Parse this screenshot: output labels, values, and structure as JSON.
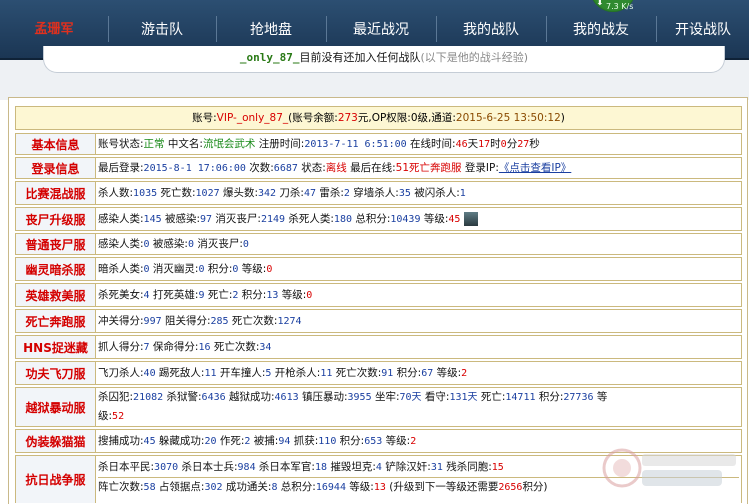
{
  "nav": {
    "brand": "孟珊军",
    "items": [
      "游击队",
      "抢地盘",
      "最近战况",
      "我的战队",
      "我的战友",
      "开设战队"
    ],
    "speed": "7.3 K/s"
  },
  "tab": {
    "username": "_only_87_",
    "message": "目前没有还加入任何战队",
    "hint": "(以下是他的战斗经验)"
  },
  "account": {
    "label_account": "账号:",
    "account": "VIP-_only_87_",
    "label_balance": "(账号余额:",
    "balance": "273",
    "label_op": "元,OP权限:",
    "op": "0级",
    "label_channel": ",通道:",
    "channel_time": "2015-6-25 13:50:12",
    "close": ")"
  },
  "basic": {
    "label": "基本信息",
    "status_label": "账号状态:",
    "status": "正常",
    "cname_label": "中文名:",
    "cname": "流氓会武术",
    "reg_label": "注册时间:",
    "reg_time": "2013-7-11 6:51:00",
    "online_label": "在线时间:",
    "online_d": "46",
    "online_h": "17",
    "online_m": "0",
    "online_s": "27"
  },
  "login": {
    "label": "登录信息",
    "last_label": "最后登录:",
    "last": "2015-8-1 17:06:00",
    "times_label": "次数:",
    "times": "6687",
    "state_label": "状态:",
    "state": "离线",
    "where_label": "最后在线:",
    "where": "51死亡奔跑服",
    "ip_label": "登录IP:",
    "ip": "《点击查看IP》"
  },
  "rows": {
    "mix": {
      "label": "比赛混战服",
      "text": [
        "杀人数:",
        "1035",
        " 死亡数:",
        "1027",
        " 爆头数:",
        "342",
        " 刀杀:",
        "47",
        " 雷杀:",
        "2",
        " 穿墙杀人:",
        "35",
        " 被闪杀人:",
        "1"
      ]
    },
    "zombie": {
      "label": "丧尸升级服",
      "text": [
        "感染人类:",
        "145",
        " 被感染:",
        "97",
        " 消灭丧尸:",
        "2149",
        " 杀死人类:",
        "180",
        " 总积分:",
        "10439",
        " 等级:",
        "45"
      ]
    },
    "normal": {
      "label": "普通丧尸服",
      "text": [
        "感染人类:",
        "0",
        " 被感染:",
        "0",
        " 消灭丧尸:",
        "0"
      ]
    },
    "ghost": {
      "label": "幽灵暗杀服",
      "text": [
        "暗杀人类:",
        "0",
        " 消灭幽灵:",
        "0",
        " 积分:",
        "0",
        " 等级:",
        "0"
      ]
    },
    "hero": {
      "label": "英雄救美服",
      "text": [
        "杀死美女:",
        "4",
        " 打死英雄:",
        "9",
        " 死亡:",
        "2",
        " 积分:",
        "13",
        " 等级:",
        "0"
      ]
    },
    "death": {
      "label": "死亡奔跑服",
      "text": [
        "冲关得分:",
        "997",
        " 阻关得分:",
        "285",
        " 死亡次数:",
        "1274"
      ]
    },
    "hns": {
      "label": "HNS捉迷藏",
      "text": [
        "抓人得分:",
        "7",
        " 保命得分:",
        "16",
        " 死亡次数:",
        "34"
      ]
    },
    "kungfu": {
      "label": "功夫飞刀服",
      "text": [
        "飞刀杀人:",
        "40",
        " 踢死敌人:",
        "11",
        " 开车撞人:",
        "5",
        " 开枪杀人:",
        "11",
        " 死亡次数:",
        "91",
        " 积分:",
        "67",
        " 等级:",
        "2"
      ]
    },
    "prison": {
      "label": "越狱暴动服",
      "line1": [
        "杀囚犯:",
        "21082",
        " 杀狱警:",
        "6436",
        " 越狱成功:",
        "4613",
        " 镇压暴动:",
        "3955",
        " 坐牢:",
        "70天",
        " 看守:",
        "131天",
        " 死亡:",
        "14711",
        " 积分:",
        "27736",
        " 等"
      ],
      "line2": [
        "级:",
        "52"
      ]
    },
    "disguise": {
      "label": "伪装躲猫猫",
      "text": [
        "搜捕成功:",
        "45",
        " 躲藏成功:",
        "20",
        " 作死:",
        "2",
        " 被捕:",
        "94",
        " 抓获:",
        "110",
        " 积分:",
        "653",
        " 等级:",
        "2"
      ]
    },
    "war": {
      "label": "抗日战争服",
      "line1": [
        "杀日本平民:",
        "3070",
        " 杀日本士兵:",
        "984",
        " 杀日本军官:",
        "18",
        " 摧毁坦克:",
        "4",
        " 铲除汉奸:",
        "31",
        " 残杀同胞:",
        "15"
      ],
      "line2": [
        "阵亡次数:",
        "58",
        " 占领据点:",
        "302",
        " 成功通关:",
        "8",
        " 总积分:",
        "16944",
        " 等级:",
        "13",
        " (升级到下一等级还需要",
        "2656",
        "积分)"
      ]
    }
  }
}
